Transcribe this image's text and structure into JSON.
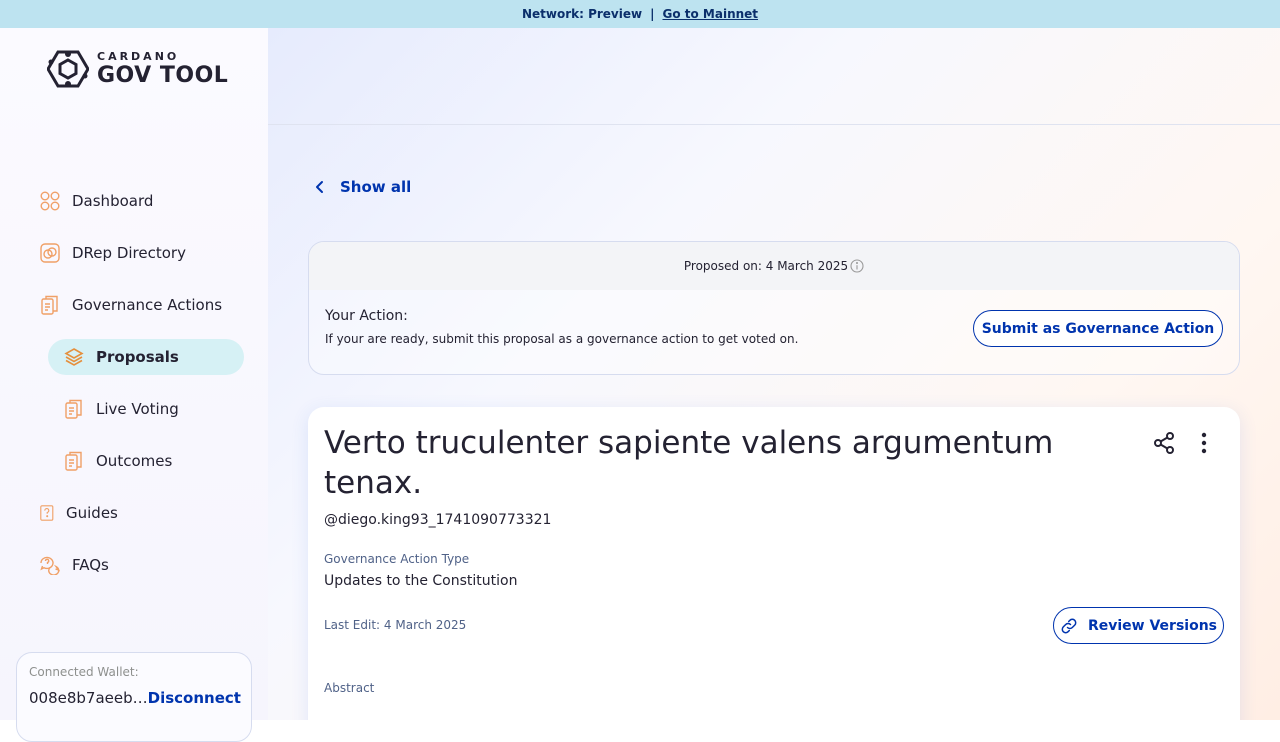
{
  "banner": {
    "network": "Network: Preview",
    "separator": "|",
    "mainnet_link": "Go to Mainnet"
  },
  "logo": {
    "small": "CARDANO",
    "big": "GOV TOOL"
  },
  "nav": {
    "dashboard": "Dashboard",
    "drep_directory": "DRep Directory",
    "governance_actions": "Governance Actions",
    "proposals": "Proposals",
    "live_voting": "Live Voting",
    "outcomes": "Outcomes",
    "guides": "Guides",
    "faqs": "FAQs"
  },
  "wallet": {
    "label": "Connected Wallet:",
    "address": "008e8b7aeeb…",
    "disconnect": "Disconnect"
  },
  "back": {
    "label": "Show all"
  },
  "action_box": {
    "proposed_on": "Proposed on: 4 March 2025",
    "your_action": "Your Action:",
    "description": "If your are ready, submit this proposal as a governance action to get voted on.",
    "submit_label": "Submit as Governance Action"
  },
  "proposal": {
    "title": "Verto truculenter sapiente valens argumentum tenax.",
    "author": "@diego.king93_1741090773321",
    "type_label": "Governance Action Type",
    "type_value": "Updates to the Constitution",
    "last_edit": "Last Edit: 4 March 2025",
    "review_versions": "Review Versions",
    "abstract_label": "Abstract"
  },
  "colors": {
    "accent": "#0034ae",
    "banner_bg": "#bde3f0",
    "active_nav_bg": "#d6f1f5",
    "icon_orange": "#f0a067"
  }
}
